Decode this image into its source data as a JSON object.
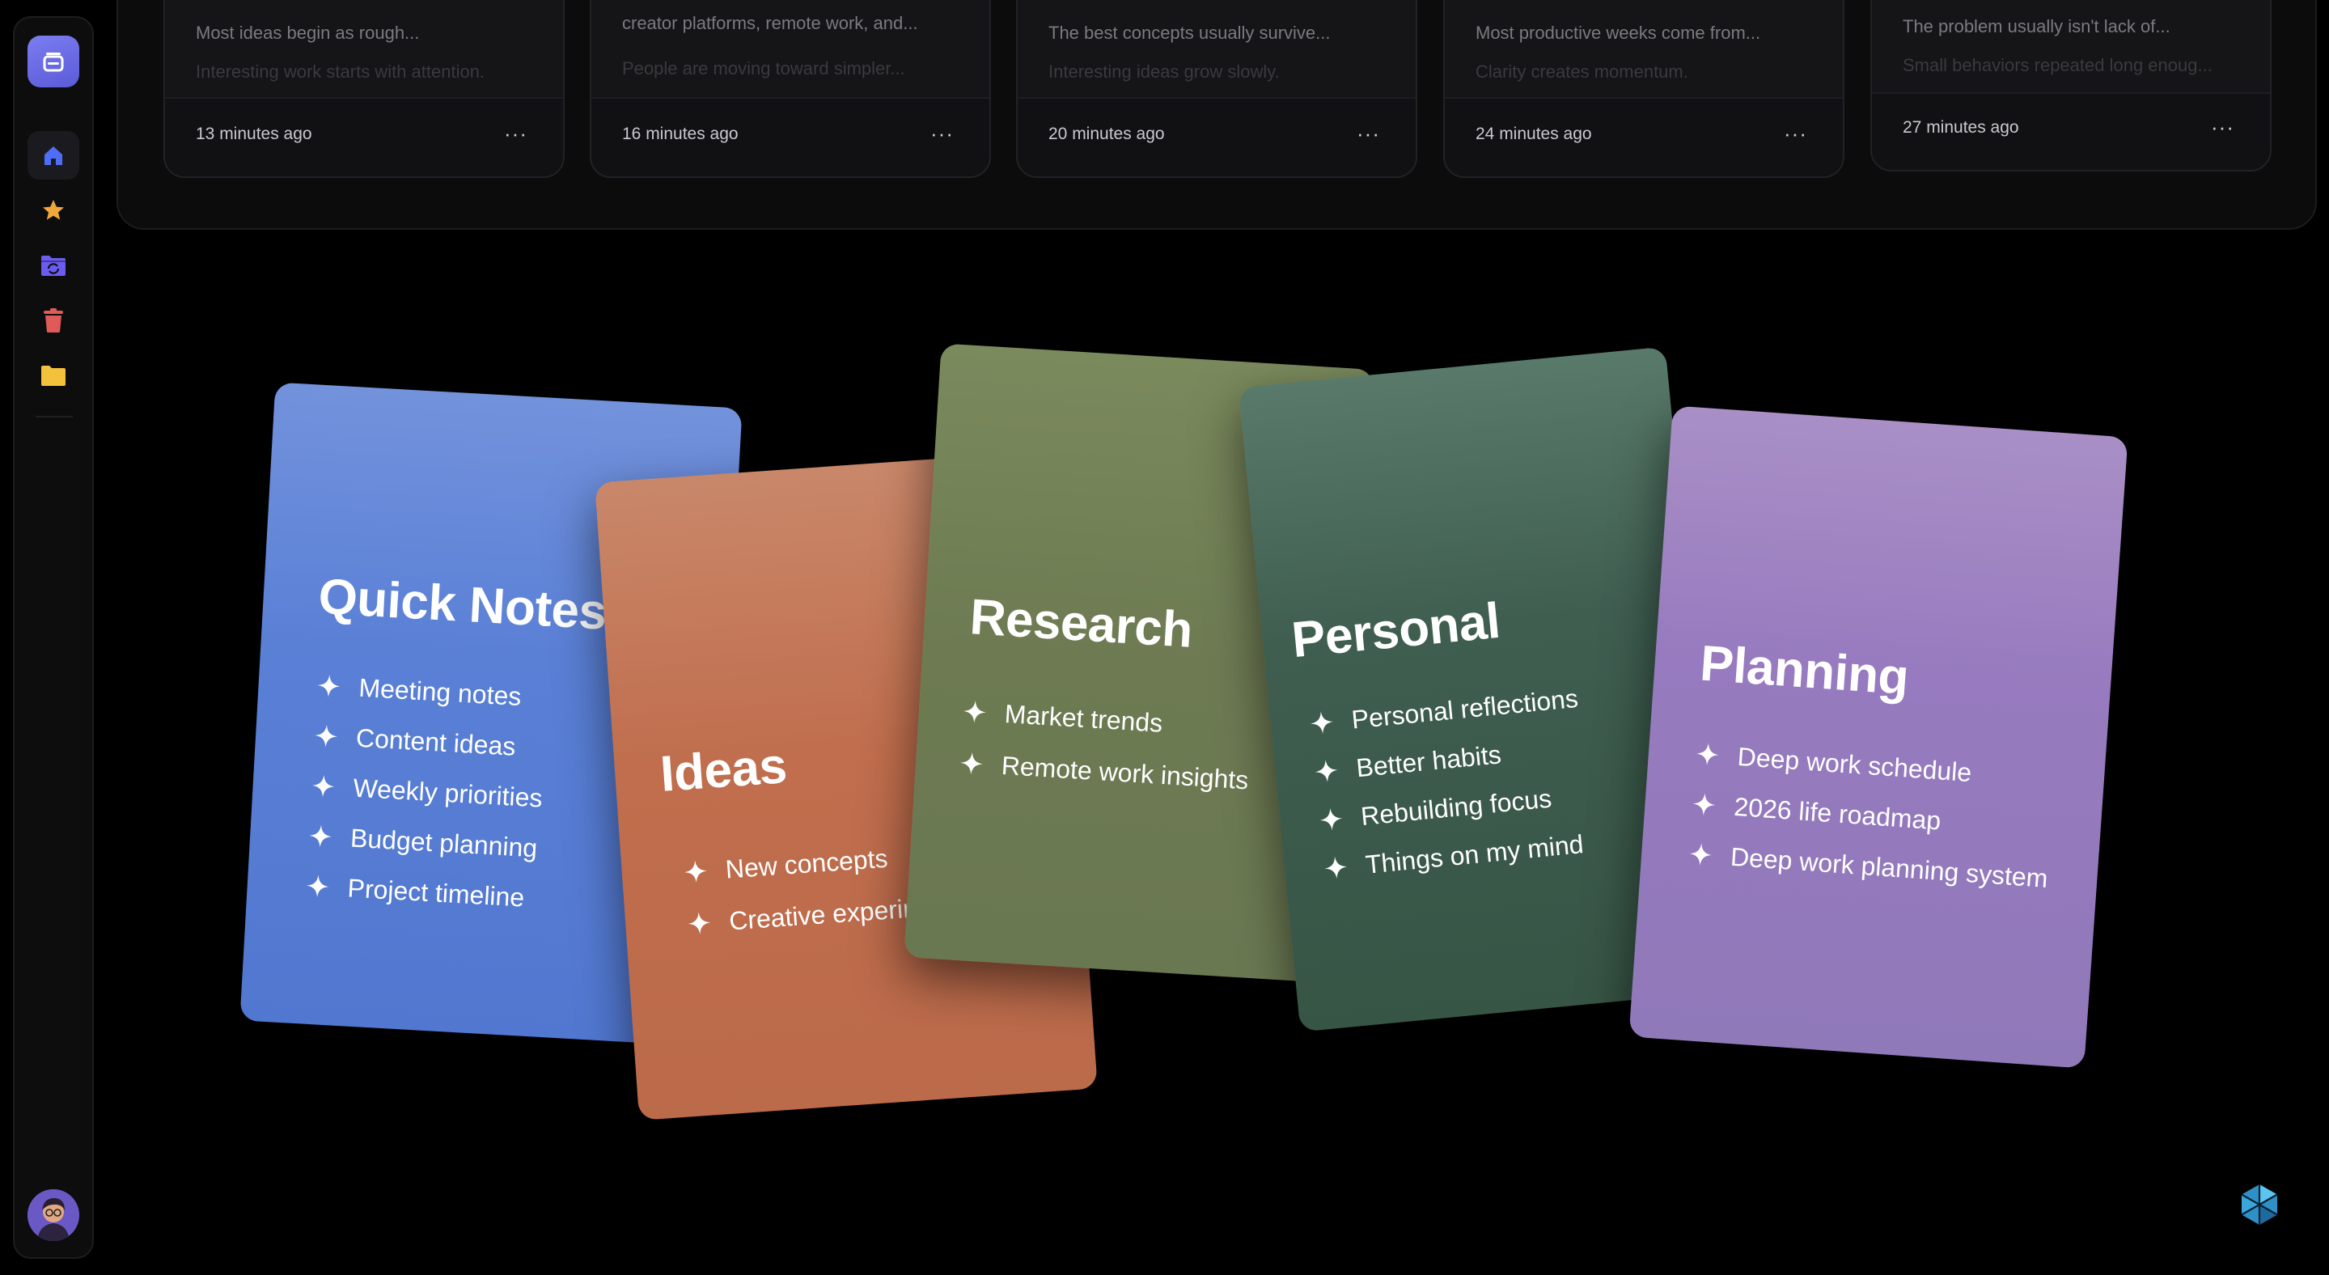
{
  "sidebar": {
    "logo_icon": "stack-icon",
    "items": [
      {
        "icon": "home-icon",
        "active": true,
        "color": "#4f6ef7"
      },
      {
        "icon": "star-icon",
        "active": false,
        "color": "#f0a83a"
      },
      {
        "icon": "sync-folder-icon",
        "active": false,
        "color": "#6b5cf0"
      },
      {
        "icon": "trash-icon",
        "active": false,
        "color": "#e05a5a"
      },
      {
        "icon": "folder-icon",
        "active": false,
        "color": "#f3c13c"
      }
    ]
  },
  "recent": [
    {
      "line1": "Most ideas begin as rough...",
      "line2": "Interesting work starts with attention.",
      "time": "13 minutes ago"
    },
    {
      "line1": "creator platforms, remote work, and...",
      "line2": "People are moving toward simpler...",
      "time": "16 minutes ago"
    },
    {
      "line1": "The best concepts usually survive...",
      "line2": "Interesting ideas grow slowly.",
      "time": "20 minutes ago"
    },
    {
      "line1": "Most productive weeks come from...",
      "line2": "Clarity creates momentum.",
      "time": "24 minutes ago"
    },
    {
      "line1": "The problem usually isn't lack of...",
      "line2": "Small behaviors repeated long enoug...",
      "time": "27 minutes ago"
    }
  ],
  "more_label": "···",
  "folders": [
    {
      "title": "Quick Notes",
      "color": "#5a80d6",
      "items": [
        "Meeting notes",
        "Content ideas",
        "Weekly priorities",
        "Budget planning",
        "Project timeline"
      ]
    },
    {
      "title": "Ideas",
      "color": "#c06e4d",
      "items": [
        "New concepts",
        "Creative experim"
      ]
    },
    {
      "title": "Research",
      "color": "#6d7a52",
      "items": [
        "Market trends",
        "Remote work insights"
      ]
    },
    {
      "title": "Personal",
      "color": "#3f5e50",
      "items": [
        "Personal reflections",
        "Better habits",
        "Rebuilding focus",
        "Things on my mind"
      ]
    },
    {
      "title": "Planning",
      "color": "#977abf",
      "items": [
        "Deep work schedule",
        "2026 life roadmap",
        "Deep work planning system"
      ]
    }
  ],
  "assistant_icon": "hexagon-assistant-icon"
}
